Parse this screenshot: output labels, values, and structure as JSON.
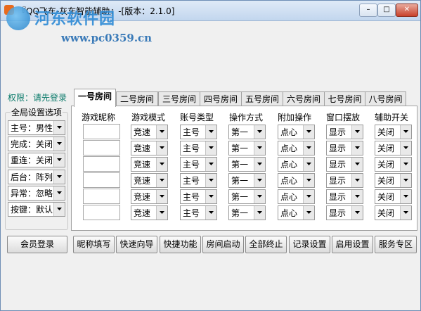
{
  "window": {
    "title": "『QQ飞车-灰车智能辅助』-[版本：2.1.0]",
    "watermark_text": "河东软件园",
    "watermark_url": "www.pc0359.cn"
  },
  "controls": {
    "minimize": "–",
    "maximize": "□",
    "close": "✕"
  },
  "permission": "权限：请先登录",
  "tabs": [
    "一号房间",
    "二号房间",
    "三号房间",
    "四号房间",
    "五号房间",
    "六号房间",
    "七号房间",
    "八号房间"
  ],
  "active_tab": 0,
  "global_settings": {
    "title": "全局设置选项",
    "items": [
      "主号：男性",
      "完成：关闭",
      "重连：关闭",
      "后台：阵列",
      "异常：忽略",
      "按键：默认"
    ]
  },
  "columns": [
    "游戏昵称",
    "游戏模式",
    "账号类型",
    "操作方式",
    "附加操作",
    "窗口摆放",
    "辅助开关"
  ],
  "rows": [
    {
      "nickname": "",
      "mode": "竞速",
      "account": "主号",
      "op": "第一",
      "extra": "点心",
      "window": "显示",
      "switch": "关闭"
    },
    {
      "nickname": "",
      "mode": "竞速",
      "account": "主号",
      "op": "第一",
      "extra": "点心",
      "window": "显示",
      "switch": "关闭"
    },
    {
      "nickname": "",
      "mode": "竞速",
      "account": "主号",
      "op": "第一",
      "extra": "点心",
      "window": "显示",
      "switch": "关闭"
    },
    {
      "nickname": "",
      "mode": "竞速",
      "account": "主号",
      "op": "第一",
      "extra": "点心",
      "window": "显示",
      "switch": "关闭"
    },
    {
      "nickname": "",
      "mode": "竞速",
      "account": "主号",
      "op": "第一",
      "extra": "点心",
      "window": "显示",
      "switch": "关闭"
    },
    {
      "nickname": "",
      "mode": "竞速",
      "account": "主号",
      "op": "第一",
      "extra": "点心",
      "window": "显示",
      "switch": "关闭"
    }
  ],
  "buttons": {
    "login": "会员登录",
    "actions": [
      "昵称填写",
      "快速向导",
      "快捷功能",
      "房间启动",
      "全部终止",
      "记录设置",
      "启用设置",
      "服务专区"
    ]
  },
  "colors": {
    "permission_text": "#0a7a6a",
    "watermark": "#2d8bd6",
    "close_button": "#c8412b"
  }
}
